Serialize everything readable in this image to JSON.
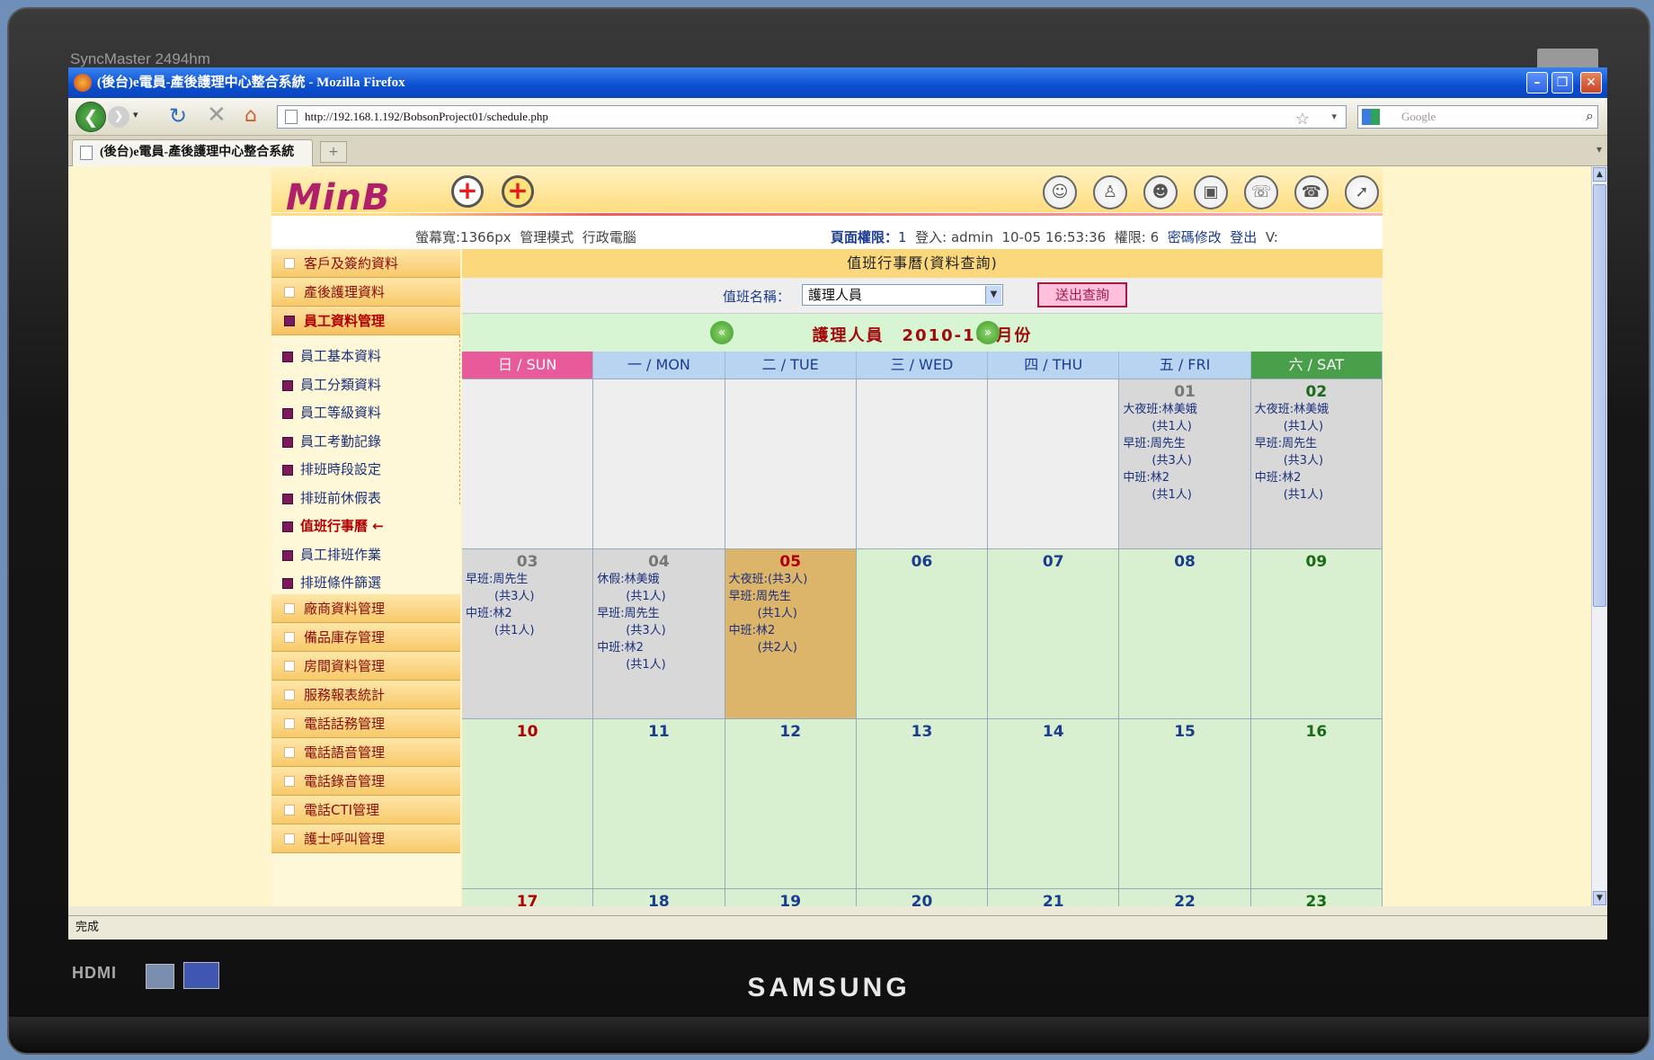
{
  "monitor": {
    "model": "SyncMaster 2494hm",
    "energy_badge": "",
    "brand": "SAMSUNG",
    "hdmi": "HDMI"
  },
  "browser": {
    "window_title": "(後台)e電員-產後護理中心整合系統 - Mozilla Firefox",
    "url": "http://192.168.1.192/BobsonProject01/schedule.php",
    "search_placeholder": "Google",
    "tab_title": "(後台)e電員-產後護理中心整合系統",
    "new_tab": "+",
    "status": "完成"
  },
  "header": {
    "logo": "MinB",
    "screen_width": "螢幕寬:1366px",
    "mode": "管理模式",
    "computer": "行政電腦",
    "page_perm_label": "頁面權限：",
    "page_perm_value": "1",
    "login_label": "登入:",
    "login_user": "admin",
    "datetime": "10-05 16:53:36",
    "perm_label": "權限:",
    "perm_value": "6",
    "change_pw": "密碼修改",
    "logout": "登出",
    "version": "V:"
  },
  "sidebar": {
    "top_items": [
      "客戶及簽約資料",
      "產後護理資料",
      "員工資料管理"
    ],
    "sub_items": [
      "員工基本資料",
      "員工分類資料",
      "員工等級資料",
      "員工考勤記錄",
      "排班時段設定",
      "排班前休假表",
      "值班行事曆 ←",
      "員工排班作業",
      "排班條件篩選"
    ],
    "bottom_items": [
      "廠商資料管理",
      "備品庫存管理",
      "房間資料管理",
      "服務報表統計",
      "電話話務管理",
      "電話語音管理",
      "電話錄音管理",
      "電話CTI管理",
      "護士呼叫管理"
    ]
  },
  "content": {
    "title": "值班行事曆(資料查詢)",
    "query_label": "值班名稱：",
    "query_value": "護理人員",
    "query_button": "送出查詢",
    "month_title": "護理人員　2010-10 月份",
    "day_headers": [
      "日 / SUN",
      "一 / MON",
      "二 / TUE",
      "三 / WED",
      "四 / THU",
      "五 / FRI",
      "六 / SAT"
    ],
    "weeks": [
      [
        {
          "day": "",
          "type": "empty",
          "entries": []
        },
        {
          "day": "",
          "type": "empty",
          "entries": []
        },
        {
          "day": "",
          "type": "empty",
          "entries": []
        },
        {
          "day": "",
          "type": "empty",
          "entries": []
        },
        {
          "day": "",
          "type": "empty",
          "entries": []
        },
        {
          "day": "01",
          "type": "past",
          "entries": [
            [
              "大夜班:林美娥",
              "(共1人)"
            ],
            [
              "早班:周先生",
              "(共3人)"
            ],
            [
              "中班:林2",
              "(共1人)"
            ]
          ]
        },
        {
          "day": "02",
          "type": "past",
          "entries": [
            [
              "大夜班:林美娥",
              "(共1人)"
            ],
            [
              "早班:周先生",
              "(共3人)"
            ],
            [
              "中班:林2",
              "(共1人)"
            ]
          ]
        }
      ],
      [
        {
          "day": "03",
          "type": "past",
          "entries": [
            [
              "早班:周先生",
              "(共3人)"
            ],
            [
              "中班:林2",
              "(共1人)"
            ]
          ]
        },
        {
          "day": "04",
          "type": "past",
          "entries": [
            [
              "休假:林美娥",
              "(共1人)"
            ],
            [
              "早班:周先生",
              "(共3人)"
            ],
            [
              "中班:林2",
              "(共1人)"
            ]
          ]
        },
        {
          "day": "05",
          "type": "today",
          "entries": [
            [
              "大夜班:(共3人)",
              ""
            ],
            [
              "早班:周先生",
              "(共1人)"
            ],
            [
              "中班:林2",
              "(共2人)"
            ]
          ]
        },
        {
          "day": "06",
          "type": "future",
          "entries": []
        },
        {
          "day": "07",
          "type": "future",
          "entries": []
        },
        {
          "day": "08",
          "type": "future",
          "entries": []
        },
        {
          "day": "09",
          "type": "future",
          "entries": []
        }
      ],
      [
        {
          "day": "10",
          "type": "future",
          "entries": []
        },
        {
          "day": "11",
          "type": "future",
          "entries": []
        },
        {
          "day": "12",
          "type": "future",
          "entries": []
        },
        {
          "day": "13",
          "type": "future",
          "entries": []
        },
        {
          "day": "14",
          "type": "future",
          "entries": []
        },
        {
          "day": "15",
          "type": "future",
          "entries": []
        },
        {
          "day": "16",
          "type": "future",
          "entries": []
        }
      ],
      [
        {
          "day": "17",
          "type": "future",
          "entries": []
        },
        {
          "day": "18",
          "type": "future",
          "entries": []
        },
        {
          "day": "19",
          "type": "future",
          "entries": []
        },
        {
          "day": "20",
          "type": "future",
          "entries": []
        },
        {
          "day": "21",
          "type": "future",
          "entries": []
        },
        {
          "day": "22",
          "type": "future",
          "entries": []
        },
        {
          "day": "23",
          "type": "future",
          "entries": []
        }
      ]
    ]
  },
  "header_icons": [
    "mother-baby-icon",
    "bottle-icon",
    "nurse-icon",
    "monitor-icon",
    "phone-icon",
    "phone-ring-icon",
    "exit-icon"
  ],
  "colors": {
    "sunday": "#e85a9a",
    "saturday": "#4aa04a",
    "today": "#dcb46a",
    "past": "#d8d8d8",
    "future": "#d8f0d0"
  }
}
